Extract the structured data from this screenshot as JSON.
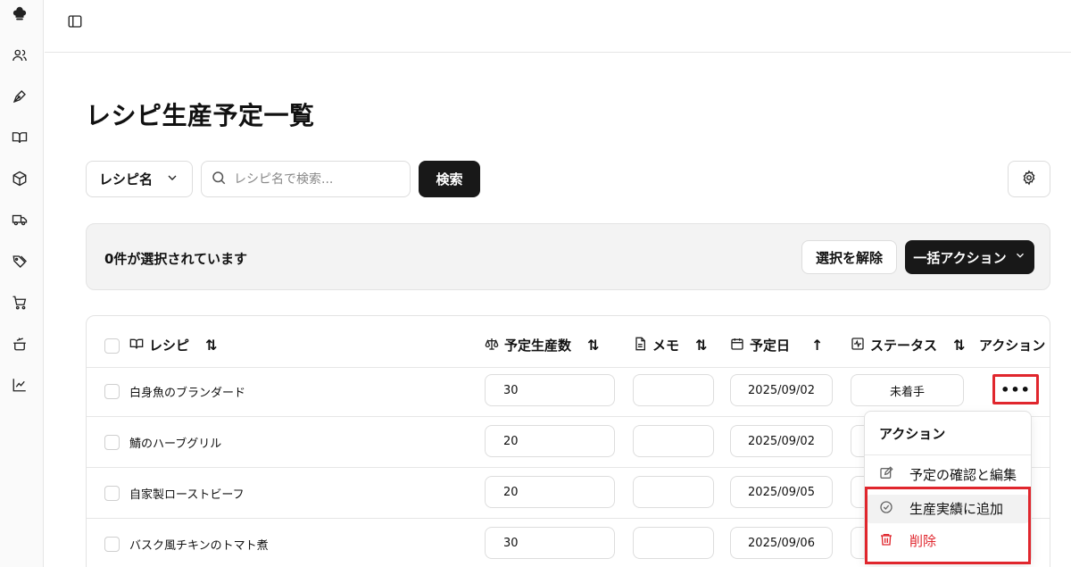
{
  "page": {
    "title": "レシピ生産予定一覧"
  },
  "filter": {
    "field_label": "レシピ名",
    "search_placeholder": "レシピ名で検索...",
    "search_button": "検索"
  },
  "selection": {
    "count_text": "0件が選択されています",
    "clear_button": "選択を解除",
    "bulk_button": "一括アクション"
  },
  "table": {
    "columns": {
      "recipe": "レシピ",
      "qty": "予定生産数",
      "memo": "メモ",
      "date": "予定日",
      "status": "ステータス",
      "action": "アクション"
    },
    "rows": [
      {
        "name": "白身魚のブランダード",
        "qty": "30",
        "memo": "",
        "date": "2025/09/02",
        "status": "未着手"
      },
      {
        "name": "鯖のハーブグリル",
        "qty": "20",
        "memo": "",
        "date": "2025/09/02",
        "status": ""
      },
      {
        "name": "自家製ローストビーフ",
        "qty": "20",
        "memo": "",
        "date": "2025/09/05",
        "status": ""
      },
      {
        "name": "バスク風チキンのトマト煮",
        "qty": "30",
        "memo": "",
        "date": "2025/09/06",
        "status": ""
      }
    ],
    "more_label": "•••"
  },
  "menu": {
    "title": "アクション",
    "items": [
      {
        "label": "予定の確認と編集"
      },
      {
        "label": "生産実績に追加"
      },
      {
        "label": "削除"
      }
    ]
  },
  "colors": {
    "accent_dark": "#181818",
    "danger": "#e0262d"
  }
}
